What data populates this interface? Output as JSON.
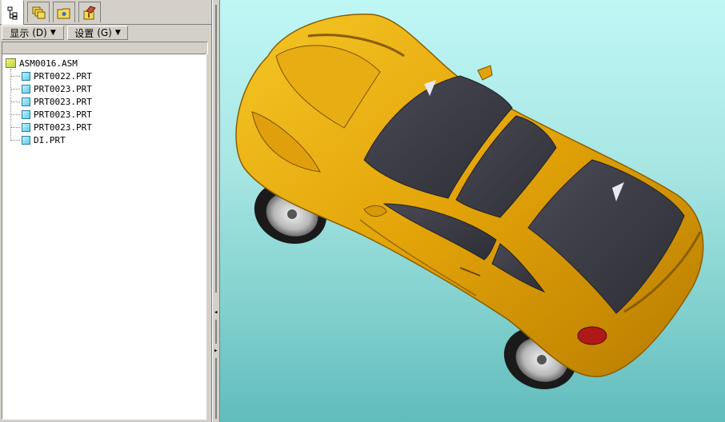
{
  "panel": {
    "tabs": [
      {
        "icon": "model-tree-icon"
      },
      {
        "icon": "layers-icon"
      },
      {
        "icon": "folder-browser-icon"
      },
      {
        "icon": "favorites-icon"
      }
    ],
    "menu": {
      "show_label": "显示",
      "show_key": "(D)",
      "settings_label": "设置",
      "settings_key": "(G)"
    },
    "tree": {
      "root": "ASM0016.ASM",
      "items": [
        "PRT0022.PRT",
        "PRT0023.PRT",
        "PRT0023.PRT",
        "PRT0023.PRT",
        "PRT0023.PRT",
        "DI.PRT"
      ]
    }
  },
  "colors": {
    "body_paint": "#e2a308",
    "glass": "#3b3b45",
    "background_top": "#bff7f5",
    "background_bottom": "#61bcbc",
    "tail_light": "#b01818"
  }
}
